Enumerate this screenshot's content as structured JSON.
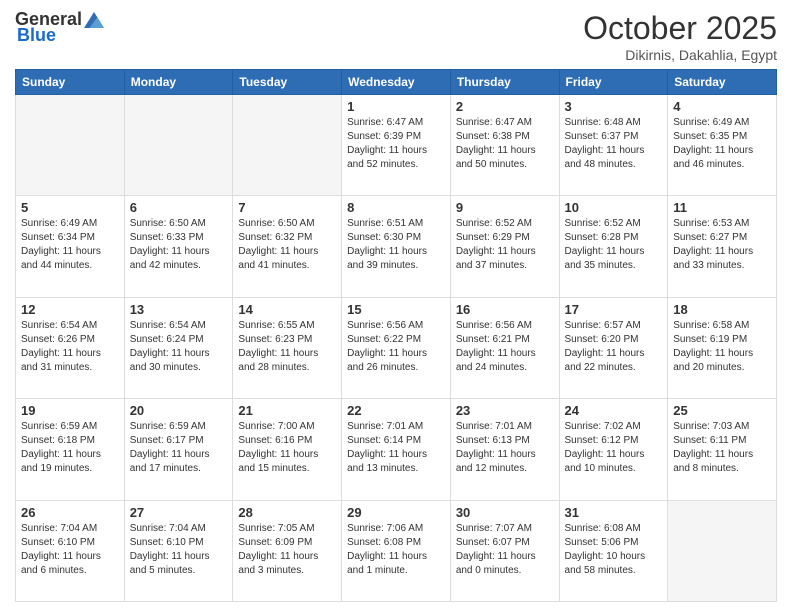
{
  "header": {
    "logo_general": "General",
    "logo_blue": "Blue",
    "month": "October 2025",
    "location": "Dikirnis, Dakahlia, Egypt"
  },
  "weekdays": [
    "Sunday",
    "Monday",
    "Tuesday",
    "Wednesday",
    "Thursday",
    "Friday",
    "Saturday"
  ],
  "weeks": [
    [
      {
        "day": "",
        "info": ""
      },
      {
        "day": "",
        "info": ""
      },
      {
        "day": "",
        "info": ""
      },
      {
        "day": "1",
        "info": "Sunrise: 6:47 AM\nSunset: 6:39 PM\nDaylight: 11 hours\nand 52 minutes."
      },
      {
        "day": "2",
        "info": "Sunrise: 6:47 AM\nSunset: 6:38 PM\nDaylight: 11 hours\nand 50 minutes."
      },
      {
        "day": "3",
        "info": "Sunrise: 6:48 AM\nSunset: 6:37 PM\nDaylight: 11 hours\nand 48 minutes."
      },
      {
        "day": "4",
        "info": "Sunrise: 6:49 AM\nSunset: 6:35 PM\nDaylight: 11 hours\nand 46 minutes."
      }
    ],
    [
      {
        "day": "5",
        "info": "Sunrise: 6:49 AM\nSunset: 6:34 PM\nDaylight: 11 hours\nand 44 minutes."
      },
      {
        "day": "6",
        "info": "Sunrise: 6:50 AM\nSunset: 6:33 PM\nDaylight: 11 hours\nand 42 minutes."
      },
      {
        "day": "7",
        "info": "Sunrise: 6:50 AM\nSunset: 6:32 PM\nDaylight: 11 hours\nand 41 minutes."
      },
      {
        "day": "8",
        "info": "Sunrise: 6:51 AM\nSunset: 6:30 PM\nDaylight: 11 hours\nand 39 minutes."
      },
      {
        "day": "9",
        "info": "Sunrise: 6:52 AM\nSunset: 6:29 PM\nDaylight: 11 hours\nand 37 minutes."
      },
      {
        "day": "10",
        "info": "Sunrise: 6:52 AM\nSunset: 6:28 PM\nDaylight: 11 hours\nand 35 minutes."
      },
      {
        "day": "11",
        "info": "Sunrise: 6:53 AM\nSunset: 6:27 PM\nDaylight: 11 hours\nand 33 minutes."
      }
    ],
    [
      {
        "day": "12",
        "info": "Sunrise: 6:54 AM\nSunset: 6:26 PM\nDaylight: 11 hours\nand 31 minutes."
      },
      {
        "day": "13",
        "info": "Sunrise: 6:54 AM\nSunset: 6:24 PM\nDaylight: 11 hours\nand 30 minutes."
      },
      {
        "day": "14",
        "info": "Sunrise: 6:55 AM\nSunset: 6:23 PM\nDaylight: 11 hours\nand 28 minutes."
      },
      {
        "day": "15",
        "info": "Sunrise: 6:56 AM\nSunset: 6:22 PM\nDaylight: 11 hours\nand 26 minutes."
      },
      {
        "day": "16",
        "info": "Sunrise: 6:56 AM\nSunset: 6:21 PM\nDaylight: 11 hours\nand 24 minutes."
      },
      {
        "day": "17",
        "info": "Sunrise: 6:57 AM\nSunset: 6:20 PM\nDaylight: 11 hours\nand 22 minutes."
      },
      {
        "day": "18",
        "info": "Sunrise: 6:58 AM\nSunset: 6:19 PM\nDaylight: 11 hours\nand 20 minutes."
      }
    ],
    [
      {
        "day": "19",
        "info": "Sunrise: 6:59 AM\nSunset: 6:18 PM\nDaylight: 11 hours\nand 19 minutes."
      },
      {
        "day": "20",
        "info": "Sunrise: 6:59 AM\nSunset: 6:17 PM\nDaylight: 11 hours\nand 17 minutes."
      },
      {
        "day": "21",
        "info": "Sunrise: 7:00 AM\nSunset: 6:16 PM\nDaylight: 11 hours\nand 15 minutes."
      },
      {
        "day": "22",
        "info": "Sunrise: 7:01 AM\nSunset: 6:14 PM\nDaylight: 11 hours\nand 13 minutes."
      },
      {
        "day": "23",
        "info": "Sunrise: 7:01 AM\nSunset: 6:13 PM\nDaylight: 11 hours\nand 12 minutes."
      },
      {
        "day": "24",
        "info": "Sunrise: 7:02 AM\nSunset: 6:12 PM\nDaylight: 11 hours\nand 10 minutes."
      },
      {
        "day": "25",
        "info": "Sunrise: 7:03 AM\nSunset: 6:11 PM\nDaylight: 11 hours\nand 8 minutes."
      }
    ],
    [
      {
        "day": "26",
        "info": "Sunrise: 7:04 AM\nSunset: 6:10 PM\nDaylight: 11 hours\nand 6 minutes."
      },
      {
        "day": "27",
        "info": "Sunrise: 7:04 AM\nSunset: 6:10 PM\nDaylight: 11 hours\nand 5 minutes."
      },
      {
        "day": "28",
        "info": "Sunrise: 7:05 AM\nSunset: 6:09 PM\nDaylight: 11 hours\nand 3 minutes."
      },
      {
        "day": "29",
        "info": "Sunrise: 7:06 AM\nSunset: 6:08 PM\nDaylight: 11 hours\nand 1 minute."
      },
      {
        "day": "30",
        "info": "Sunrise: 7:07 AM\nSunset: 6:07 PM\nDaylight: 11 hours\nand 0 minutes."
      },
      {
        "day": "31",
        "info": "Sunrise: 6:08 AM\nSunset: 5:06 PM\nDaylight: 10 hours\nand 58 minutes."
      },
      {
        "day": "",
        "info": ""
      }
    ]
  ]
}
